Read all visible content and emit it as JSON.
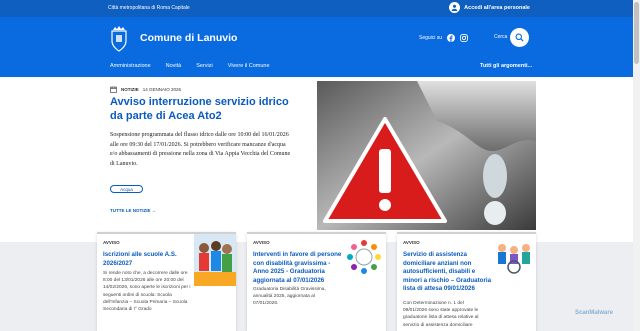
{
  "topbar": {
    "org": "Città metropolitana di Roma Capitale",
    "login": "Accedi all'area personale"
  },
  "header": {
    "title": "Comune di Lanuvio",
    "follow": "Seguici su",
    "search": "Cerca"
  },
  "nav": {
    "items": [
      "Amministrazione",
      "Novità",
      "Servizi",
      "Vivere il Comune"
    ],
    "all_topics": "Tutti gli argomenti..."
  },
  "hero": {
    "category": "NOTIZIE",
    "date": "14 GENNAIO 2026",
    "headline": "Avviso interruzione servizio idrico da parte di Acea Ato2",
    "abstract": "Sospensione programmata del flusso idrico dalle ore 10:00 del 16/01/2026 alle ore 09:30 del 17/01/2026. Si potrebbero verificare mancanze d'acqua e/o abbassamenti di pressione nella zona di Via Appia Vecchia del Comune di Lanuvio.",
    "topic": "Acqua",
    "all_news": "TUTTE LE NOTIZIE"
  },
  "cards": [
    {
      "type": "AVVISO",
      "title": "Iscrizioni alle scuole A.S. 2026/2027",
      "text": "Si rende noto che, a decorrere dalle ore 8:00 del 13/01/2026 alle ore 20:00 del 14/02/2026, sono aperte le iscrizioni per i seguenti ordini di scuola: Scuola dell'Infanzia – Scuola Primaria – Scuola Secondaria di I° Grado"
    },
    {
      "type": "AVVISO",
      "title": "Interventi in favore di persone con disabilità gravissima - Anno 2025 - Graduatoria aggiornata al 07/01/2026",
      "text": "Graduatoria Disabilità Gravissima, annualità 2025, aggiornata al 07/01/2026."
    },
    {
      "type": "AVVISO",
      "title": "Servizio di assistenza domiciliare anziani non autosufficienti, disabili e minori a rischio – Graduatoria lista di attesa 09/01/2026",
      "text": "Con Determinazione n. 1 del 09/01/2026 sono state approvate le graduatorie lista di attesa relative al servizio di assistenza domiciliare"
    }
  ],
  "watermark": "ScanMalware",
  "colors": {
    "primary": "#0a6adf",
    "topbar": "#0e5fbf",
    "link": "#0a5bbf"
  }
}
